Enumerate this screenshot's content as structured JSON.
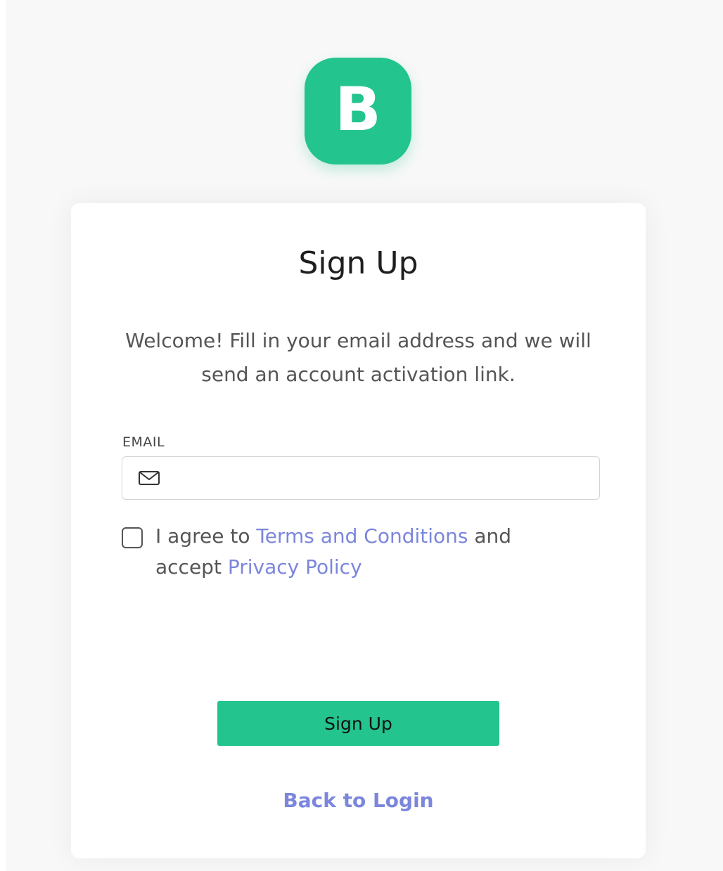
{
  "logo": {
    "letter": "B",
    "color": "#23c48e"
  },
  "card": {
    "title": "Sign Up",
    "intro": "Welcome! Fill in your email address and we will send an account activation link.",
    "email": {
      "label": "EMAIL",
      "value": "",
      "placeholder": "",
      "icon": "mail-icon"
    },
    "agreement": {
      "checked": false,
      "text_prefix": "I agree to ",
      "terms_link": "Terms and Conditions",
      "text_middle": " and accept ",
      "privacy_link": "Privacy Policy"
    },
    "signup_button": "Sign Up",
    "back_link": "Back to Login"
  },
  "colors": {
    "accent": "#23c48e",
    "link": "#7b86dc",
    "text": "#555555",
    "background": "#f8f8f8"
  }
}
